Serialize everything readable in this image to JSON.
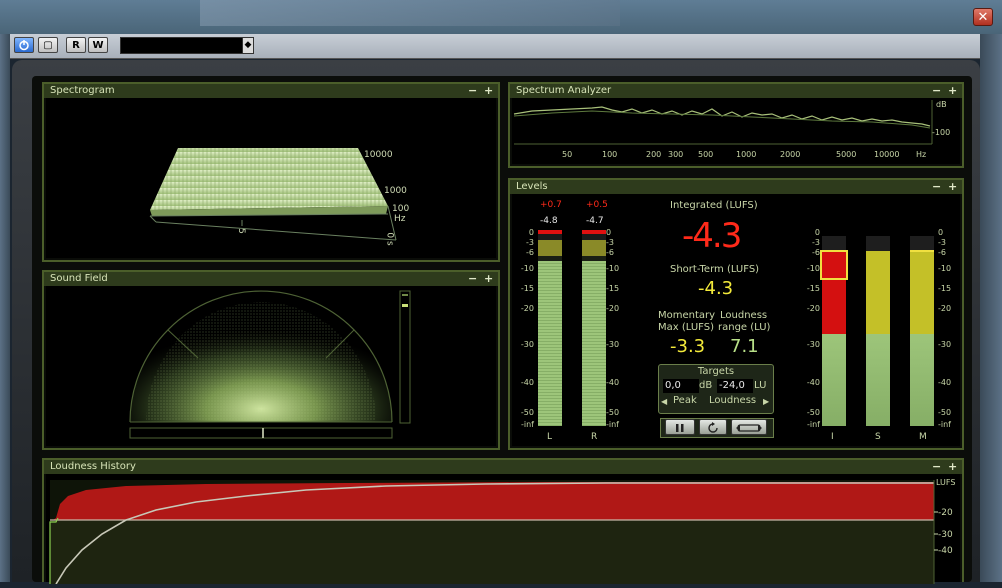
{
  "window": {
    "close_glyph": "✕"
  },
  "toolbar": {
    "power_icon": "power-icon",
    "monitor_label": "▢",
    "read_label": "R",
    "write_label": "W",
    "preset_value": ""
  },
  "panels": {
    "spectrogram": {
      "title": "Spectrogram",
      "ticks_hz": [
        "10000",
        "1000",
        "100",
        "Hz"
      ],
      "ticks_time": [
        "5",
        "0 s"
      ]
    },
    "spectrum": {
      "title": "Spectrum Analyzer",
      "db_label": "dB",
      "db_ticks": [
        "-100"
      ],
      "freq_ticks": [
        "50",
        "100",
        "200",
        "300",
        "500",
        "1000",
        "2000",
        "5000",
        "10000",
        "Hz"
      ]
    },
    "soundfield": {
      "title": "Sound Field"
    },
    "levels": {
      "title": "Levels",
      "l_peak_red": "+0.7",
      "r_peak_red": "+0.5",
      "l_peak": "-4.8",
      "r_peak": "-4.7",
      "scale": [
        "0",
        "-3",
        "-6",
        "-10",
        "-15",
        "-20",
        "-30",
        "-40",
        "-50",
        "-inf"
      ],
      "l_label": "L",
      "r_label": "R",
      "integrated_label": "Integrated (LUFS)",
      "integrated_value": "-4.3",
      "shortterm_label": "Short-Term (LUFS)",
      "shortterm_value": "-4.3",
      "momentary_label": "Momentary",
      "momentary_label2": "Max (LUFS)",
      "momentary_value": "-3.3",
      "range_label": "Loudness",
      "range_label2": "range (LU)",
      "range_value": "7.1",
      "targets_title": "Targets",
      "peak_target": "0,0",
      "peak_unit": "dB",
      "loud_target": "-24,0",
      "loud_unit": "LU",
      "peak_label": "Peak",
      "loudness_label": "Loudness",
      "i_label": "I",
      "s_label": "S",
      "m_label": "M"
    },
    "history": {
      "title": "Loudness History",
      "unit": "LUFS",
      "ticks": [
        "-20",
        "-30",
        "-40"
      ]
    }
  },
  "panel_ctl": {
    "minus": "−",
    "plus": "+"
  },
  "levels_fill": {
    "L": 0.92,
    "R": 0.93,
    "I": 0.95,
    "S": 0.95,
    "M": 0.95
  }
}
